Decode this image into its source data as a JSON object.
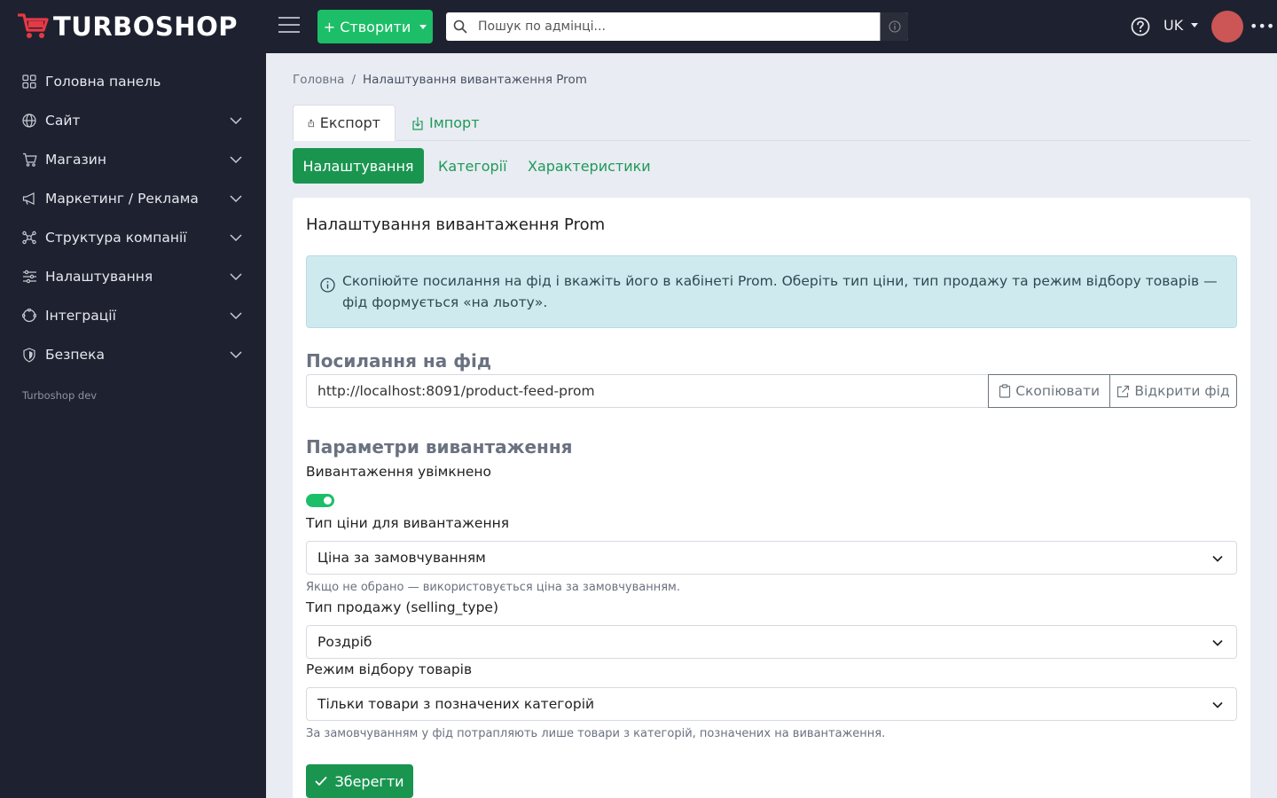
{
  "brand": {
    "name": "TURBOSHOP",
    "accent": "#e63946"
  },
  "topbar": {
    "create_label": "+ Створити",
    "search_placeholder": "Пошук по адмінці...",
    "language": "UK",
    "avatar_color": "#cc5556"
  },
  "sidebar": {
    "items": [
      {
        "label": "Головна панель",
        "icon": "dashboard-icon",
        "expandable": false
      },
      {
        "label": "Сайт",
        "icon": "globe-icon",
        "expandable": true
      },
      {
        "label": "Магазин",
        "icon": "cart-icon",
        "expandable": true
      },
      {
        "label": "Маркетинг / Реклама",
        "icon": "megaphone-icon",
        "expandable": true
      },
      {
        "label": "Структура компанії",
        "icon": "structure-icon",
        "expandable": true
      },
      {
        "label": "Налаштування",
        "icon": "sliders-icon",
        "expandable": true
      },
      {
        "label": "Інтеграції",
        "icon": "integrations-icon",
        "expandable": true
      },
      {
        "label": "Безпека",
        "icon": "shield-icon",
        "expandable": true
      }
    ],
    "footer": "Turboshop dev"
  },
  "breadcrumb": {
    "home": "Головна",
    "separator": "/",
    "current": "Налаштування вивантаження Prom"
  },
  "tabs": {
    "export": "Експорт",
    "import": "Імпорт"
  },
  "subtabs": {
    "settings": "Налаштування",
    "categories": "Категорії",
    "characteristics": "Характеристики"
  },
  "card": {
    "title": "Налаштування вивантаження Prom",
    "alert": "Скопіюйте посилання на фід і вкажіть його в кабінеті Prom. Оберіть тип ціни, тип продажу та режим відбору товарів — фід формується «на льоту».",
    "feed_section": "Посилання на фід",
    "feed_url": "http://localhost:8091/product-feed-prom",
    "copy_label": "Скопіювати",
    "open_label": "Відкрити фід",
    "params_section": "Параметри вивантаження",
    "enabled_label": "Вивантаження увімкнено",
    "enabled": true,
    "price_type_label": "Тип ціни для вивантаження",
    "price_type_value": "Ціна за замовчуванням",
    "price_type_hint": "Якщо не обрано — використовується ціна за замовчуванням.",
    "selling_type_label": "Тип продажу (selling_type)",
    "selling_type_value": "Роздріб",
    "mode_label": "Режим відбору товарів",
    "mode_value": "Тільки товари з позначених категорій",
    "mode_hint": "За замовчуванням у фід потрапляють лише товари з категорій, позначених на вивантаження.",
    "save_label": "Зберегти"
  },
  "colors": {
    "primary_green": "#1a9550",
    "bright_green": "#1dbe68",
    "sidebar_bg": "#1e2230"
  }
}
